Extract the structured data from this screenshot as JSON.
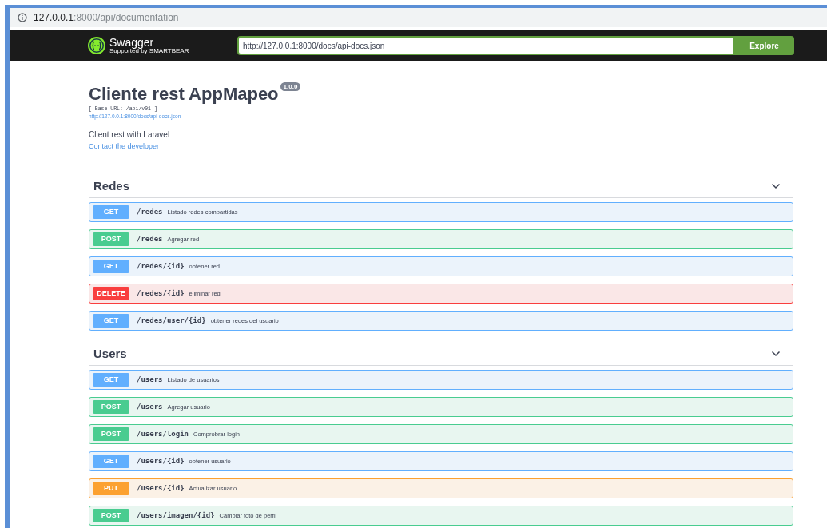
{
  "address_bar": {
    "host": "127.0.0.1",
    "rest": ":8000/api/documentation"
  },
  "topbar": {
    "logo_text": "Swagger",
    "logo_subtext": "Supported by SMARTBEAR",
    "spec_url": "http://127.0.0.1:8000/docs/api-docs.json",
    "explore_button": "Explore"
  },
  "info": {
    "title": "Cliente rest AppMapeo",
    "version": "1.0.0",
    "base_url": "[ Base URL: /api/v01 ]",
    "spec_link": "http://127.0.0.1:8000/docs/api-docs.json",
    "description": "Client rest with Laravel",
    "contact_link": "Contact the developer"
  },
  "sections": [
    {
      "name": "Redes",
      "expanded": true,
      "operations": [
        {
          "method": "GET",
          "path": "/redes",
          "summary": "Listado redes compartidas"
        },
        {
          "method": "POST",
          "path": "/redes",
          "summary": "Agregar red"
        },
        {
          "method": "GET",
          "path": "/redes/{id}",
          "summary": "obtener red"
        },
        {
          "method": "DELETE",
          "path": "/redes/{id}",
          "summary": "eliminar red"
        },
        {
          "method": "GET",
          "path": "/redes/user/{id}",
          "summary": "obtener redes del usuario"
        }
      ]
    },
    {
      "name": "Users",
      "expanded": true,
      "operations": [
        {
          "method": "GET",
          "path": "/users",
          "summary": "Listado de usuarios"
        },
        {
          "method": "POST",
          "path": "/users",
          "summary": "Agregar usuario"
        },
        {
          "method": "POST",
          "path": "/users/login",
          "summary": "Comprobrar login"
        },
        {
          "method": "GET",
          "path": "/users/{id}",
          "summary": "obtener usuario"
        },
        {
          "method": "PUT",
          "path": "/users/{id}",
          "summary": "Actualizar usuario"
        },
        {
          "method": "POST",
          "path": "/users/imagen/{id}",
          "summary": "Cambiar foto de perfil"
        }
      ]
    }
  ]
}
